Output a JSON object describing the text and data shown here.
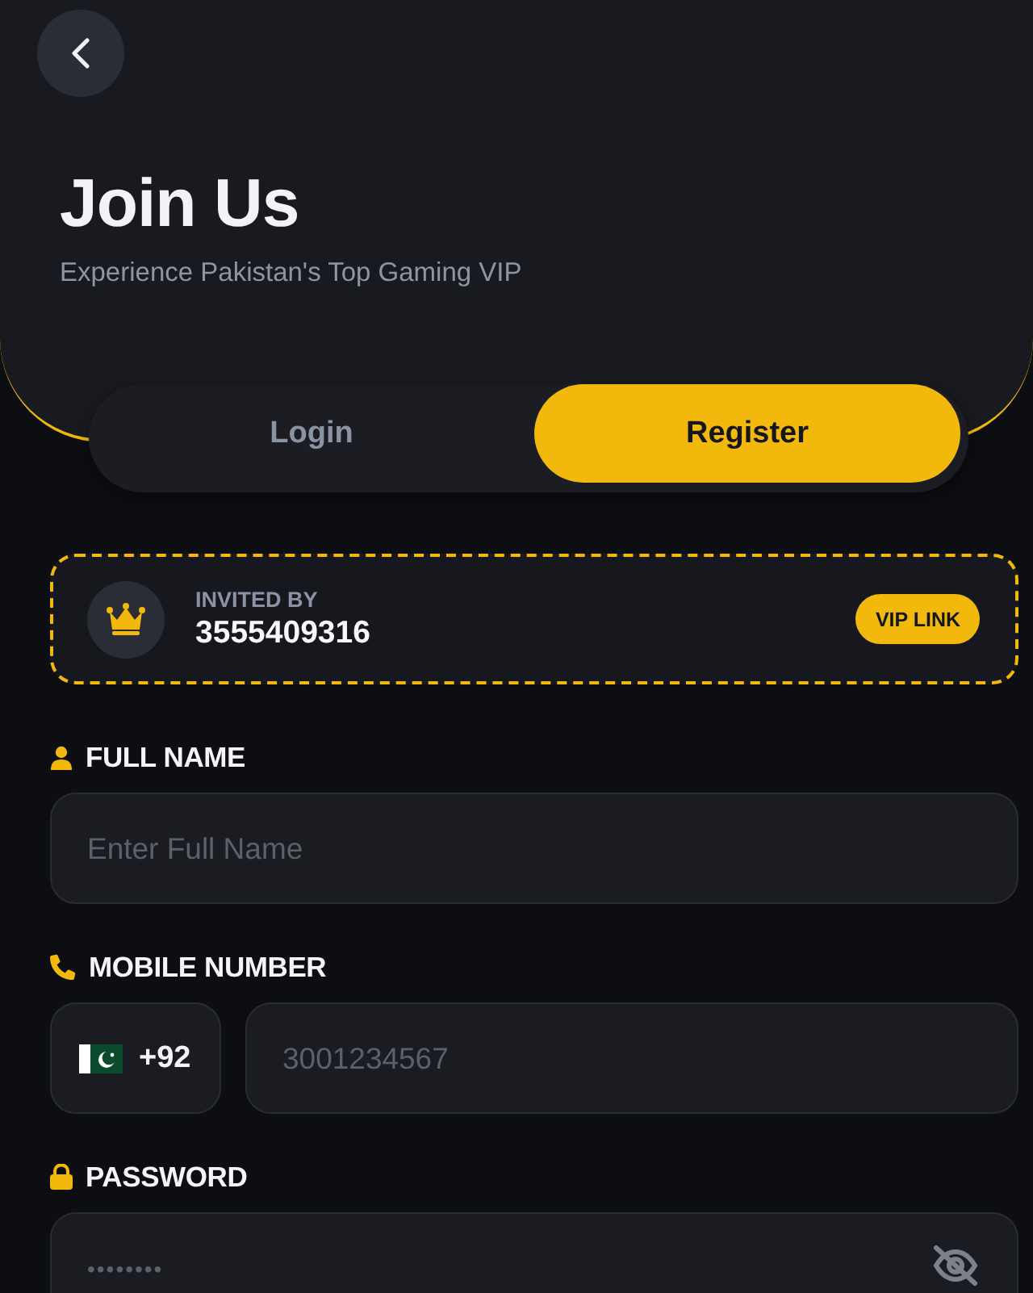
{
  "header": {
    "title": "Join Us",
    "subtitle": "Experience Pakistan's Top Gaming VIP"
  },
  "tabs": [
    {
      "label": "Login",
      "selected": false
    },
    {
      "label": "Register",
      "selected": true
    }
  ],
  "invite": {
    "label": "INVITED BY",
    "code": "3555409316",
    "badge": "VIP LINK"
  },
  "fields": [
    {
      "kind": "text",
      "label": "FULL NAME",
      "placeholder": "Enter Full Name"
    },
    {
      "kind": "phone",
      "label": "MOBILE NUMBER",
      "country_code": "+92",
      "placeholder": "3001234567"
    },
    {
      "kind": "password",
      "label": "PASSWORD",
      "placeholder": "••••••••"
    }
  ]
}
